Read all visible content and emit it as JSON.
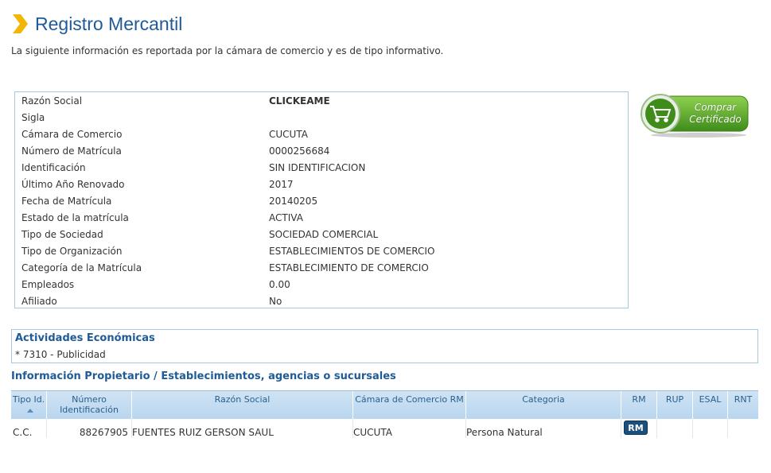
{
  "page": {
    "title": "Registro Mercantil",
    "subtitle": "La siguiente información es reportada por la cámara de comercio y es de tipo informativo."
  },
  "info": [
    {
      "label": "Razón Social",
      "value": "CLICKEAME"
    },
    {
      "label": "Sigla",
      "value": ""
    },
    {
      "label": "Cámara de Comercio",
      "value": "CUCUTA"
    },
    {
      "label": "Número de Matrícula",
      "value": "0000256684"
    },
    {
      "label": "Identificación",
      "value": "SIN IDENTIFICACION"
    },
    {
      "label": "Último Año Renovado",
      "value": "2017"
    },
    {
      "label": "Fecha de Matrícula",
      "value": "20140205"
    },
    {
      "label": "Estado de la matrícula",
      "value": "ACTIVA"
    },
    {
      "label": "Tipo de Sociedad",
      "value": "SOCIEDAD COMERCIAL"
    },
    {
      "label": "Tipo de Organización",
      "value": "ESTABLECIMIENTOS DE COMERCIO"
    },
    {
      "label": "Categoría de la Matrícula",
      "value": "ESTABLECIMIENTO DE COMERCIO"
    },
    {
      "label": "Empleados",
      "value": "0.00"
    },
    {
      "label": "Afiliado",
      "value": "No"
    }
  ],
  "certificate_button": {
    "line1": "Comprar",
    "line2": "Certificado",
    "icon": "shopping-cart-icon",
    "color": "#5aa52b"
  },
  "activities": {
    "title": "Actividades Económicas",
    "items": [
      "* 7310 - Publicidad"
    ]
  },
  "owners": {
    "title": "Información Propietario / Establecimientos, agencias o sucursales",
    "columns": [
      "Tipo Id.",
      "Número Identificación",
      "Razón Social",
      "Cámara de Comercio RM",
      "Categoria",
      "RM",
      "RUP",
      "ESAL",
      "RNT"
    ],
    "rows": [
      {
        "tipo": "C.C.",
        "numero": "88267905",
        "razon": "FUENTES RUIZ GERSON SAUL",
        "camara": "CUCUTA",
        "categoria": "Persona Natural",
        "rm_button": "RM"
      }
    ]
  },
  "colors": {
    "accent": "#1f5b97",
    "brand_chevron": "#f2b705",
    "border": "#a9c8dc",
    "button_dark": "#1b4f7e"
  }
}
